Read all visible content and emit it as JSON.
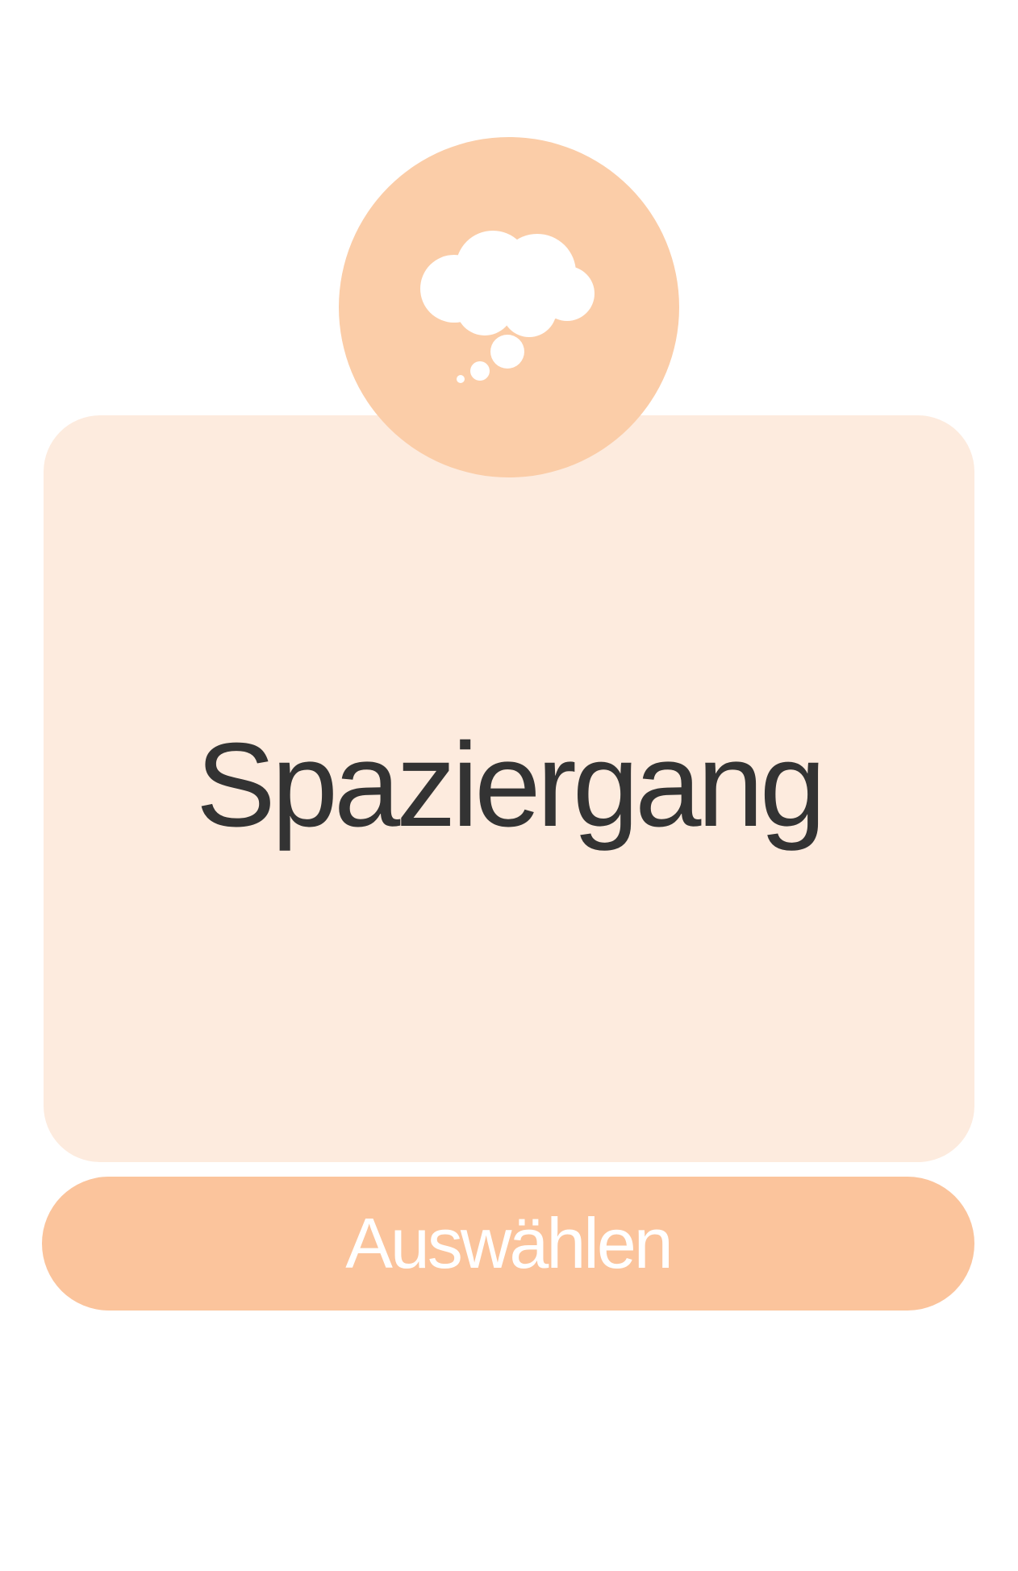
{
  "activity": {
    "title": "Spaziergang",
    "icon": "thought-bubble-icon"
  },
  "actions": {
    "select_label": "Auswählen"
  },
  "colors": {
    "background": "#ffffff",
    "card": "#fdebde",
    "icon_circle": "#fbcda8",
    "button": "#fbc49c",
    "title_text": "#333333",
    "button_text": "#ffffff"
  }
}
